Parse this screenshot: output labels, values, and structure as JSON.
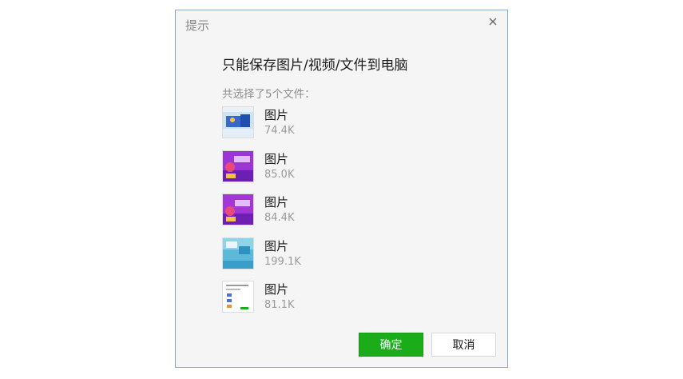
{
  "dialog": {
    "title": "提示",
    "close_icon": "close-icon",
    "message": "只能保存图片/视频/文件到电脑",
    "selected_text": "共选择了5个文件："
  },
  "files": [
    {
      "name": "图片",
      "size": "74.4K"
    },
    {
      "name": "图片",
      "size": "85.0K"
    },
    {
      "name": "图片",
      "size": "84.4K"
    },
    {
      "name": "图片",
      "size": "199.1K"
    },
    {
      "name": "图片",
      "size": "81.1K"
    }
  ],
  "buttons": {
    "ok_label": "确定",
    "cancel_label": "取消"
  },
  "colors": {
    "ok_button": "#1aad19",
    "dialog_bg": "#f5f5f5",
    "dialog_border": "#8fa6c8"
  }
}
